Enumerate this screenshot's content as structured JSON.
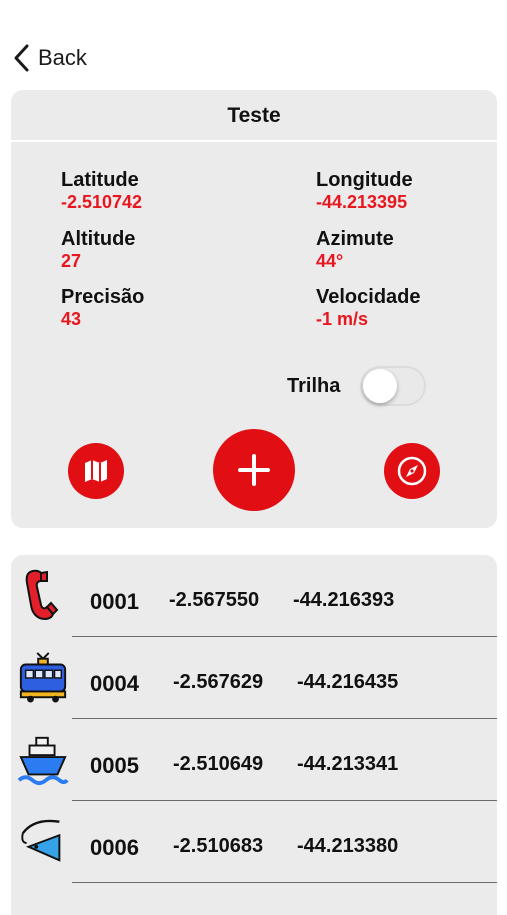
{
  "nav": {
    "back_label": "Back"
  },
  "card": {
    "title": "Teste",
    "left": [
      {
        "label": "Latitude",
        "value": "-2.510742"
      },
      {
        "label": "Altitude",
        "value": "27"
      },
      {
        "label": "Precisão",
        "value": "43"
      }
    ],
    "right": [
      {
        "label": "Longitude",
        "value": "-44.213395"
      },
      {
        "label": "Azimute",
        "value": "44°"
      },
      {
        "label": "Velocidade",
        "value": "-1 m/s"
      }
    ],
    "trilha_label": "Trilha",
    "trilha_on": false
  },
  "colors": {
    "accent": "#e10e14",
    "value_red": "#e8171f"
  },
  "points": [
    {
      "icon": "phone-icon",
      "number": "0001",
      "lat": "-2.567550",
      "lon": "-44.216393"
    },
    {
      "icon": "tram-icon",
      "number": "0004",
      "lat": "-2.567629",
      "lon": "-44.216435"
    },
    {
      "icon": "ship-icon",
      "number": "0005",
      "lat": "-2.510649",
      "lon": "-44.213341"
    },
    {
      "icon": "fishing-icon",
      "number": "0006",
      "lat": "-2.510683",
      "lon": "-44.213380"
    }
  ]
}
